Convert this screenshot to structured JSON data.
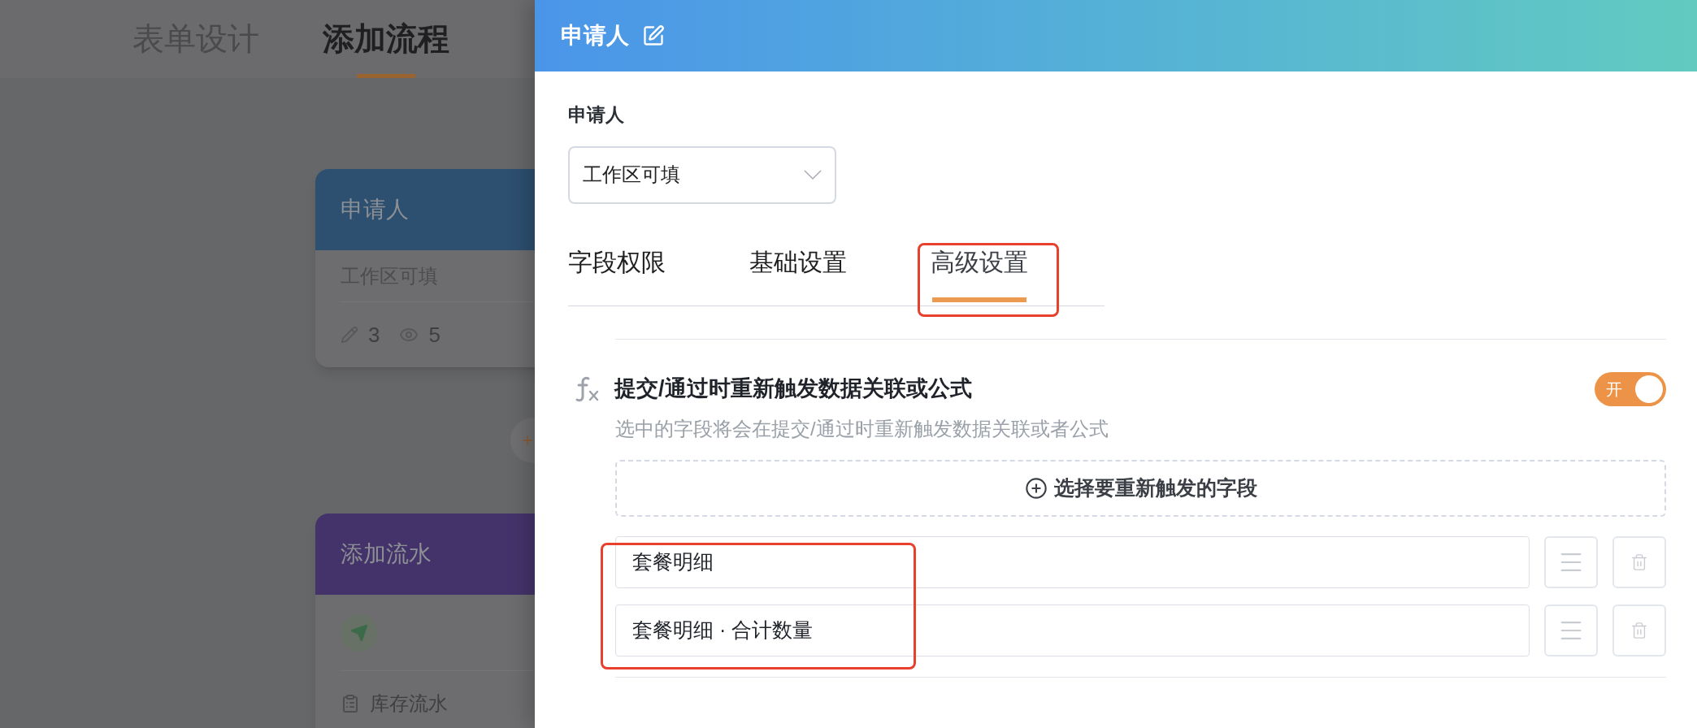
{
  "background": {
    "tabs": [
      {
        "label": "表单设计",
        "selected": false
      },
      {
        "label": "添加流程",
        "selected": true
      }
    ],
    "nodes": [
      {
        "kind": "approver",
        "title": "申请人",
        "color": "#2d4f70",
        "subtitle": "工作区可填",
        "edit_count": "3",
        "view_count": "5"
      },
      {
        "kind": "action",
        "title": "添加流水",
        "color": "#44336a",
        "target": "库存流水"
      }
    ]
  },
  "drawer": {
    "title": "申请人",
    "field_label": "申请人",
    "select": {
      "value": "工作区可填"
    },
    "tabs": [
      {
        "label": "字段权限",
        "selected": false
      },
      {
        "label": "基础设置",
        "selected": false
      },
      {
        "label": "高级设置",
        "selected": true
      }
    ],
    "setting": {
      "title": "提交/通过时重新触发数据关联或公式",
      "description": "选中的字段将会在提交/通过时重新触发数据关联或者公式",
      "on": true,
      "toggle_label": "开",
      "add_button": "选择要重新触发的字段",
      "fields": [
        {
          "label": "套餐明细"
        },
        {
          "label": "套餐明细 · 合计数量"
        }
      ]
    }
  }
}
